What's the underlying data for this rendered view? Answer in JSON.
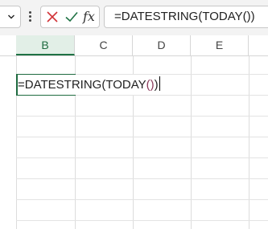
{
  "formula_bar": {
    "namebox_dropdown_icon": "chevron-down-icon",
    "cancel_icon": "close-icon",
    "enter_icon": "check-icon",
    "function_label": "fx",
    "formula": "=DATESTRING(TODAY())"
  },
  "columns": [
    "B",
    "C",
    "D",
    "E"
  ],
  "active_column": "B",
  "active_cell": {
    "text_before": "=DATESTRING(TODAY",
    "text_parens": "()",
    "text_after": ")"
  },
  "colors": {
    "accent_green": "#1f6b40",
    "cancel_red": "#d13438",
    "enter_green": "#1f7244",
    "paren_color": "#8a3a5a"
  }
}
